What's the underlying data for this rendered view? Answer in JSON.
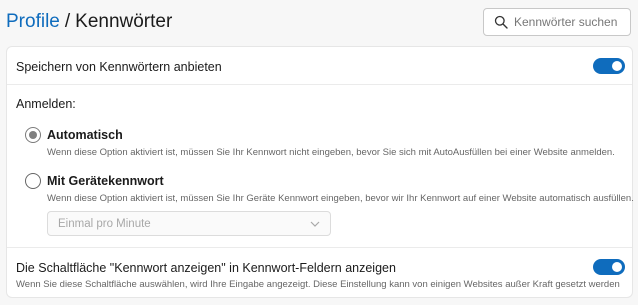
{
  "header": {
    "breadcrumb_parent": "Profile",
    "breadcrumb_separator": "/",
    "breadcrumb_current": "Kennwörter"
  },
  "search": {
    "placeholder": "Kennwörter suchen",
    "icon": "search-icon"
  },
  "settings": {
    "offer_save": {
      "label": "Speichern von Kennwörtern anbieten",
      "enabled": true
    },
    "sign_in": {
      "heading": "Anmelden:",
      "options": [
        {
          "label": "Automatisch",
          "description": "Wenn diese Option aktiviert ist, müssen Sie Ihr Kennwort nicht eingeben, bevor Sie sich mit AutoAusfüllen bei einer Website anmelden.",
          "selected": true
        },
        {
          "label": "Mit Gerätekennwort",
          "description": "Wenn diese Option aktiviert ist, müssen Sie Ihr Geräte Kennwort eingeben, bevor wir Ihr Kennwort auf einer Website automatisch ausfüllen.",
          "selected": false
        }
      ],
      "frequency_select": {
        "value": "Einmal pro Minute",
        "disabled": true
      }
    },
    "reveal_button": {
      "label": "Die Schaltfläche \"Kennwort anzeigen\" in Kennwort-Feldern anzeigen",
      "description": "Wenn Sie diese Schaltfläche auswählen, wird Ihre Eingabe angezeigt. Diese Einstellung kann von einigen Websites außer Kraft gesetzt werden",
      "enabled": true
    }
  },
  "colors": {
    "accent": "#0f6cbd",
    "page_background": "#f7f7f7",
    "card_background": "#ffffff"
  }
}
